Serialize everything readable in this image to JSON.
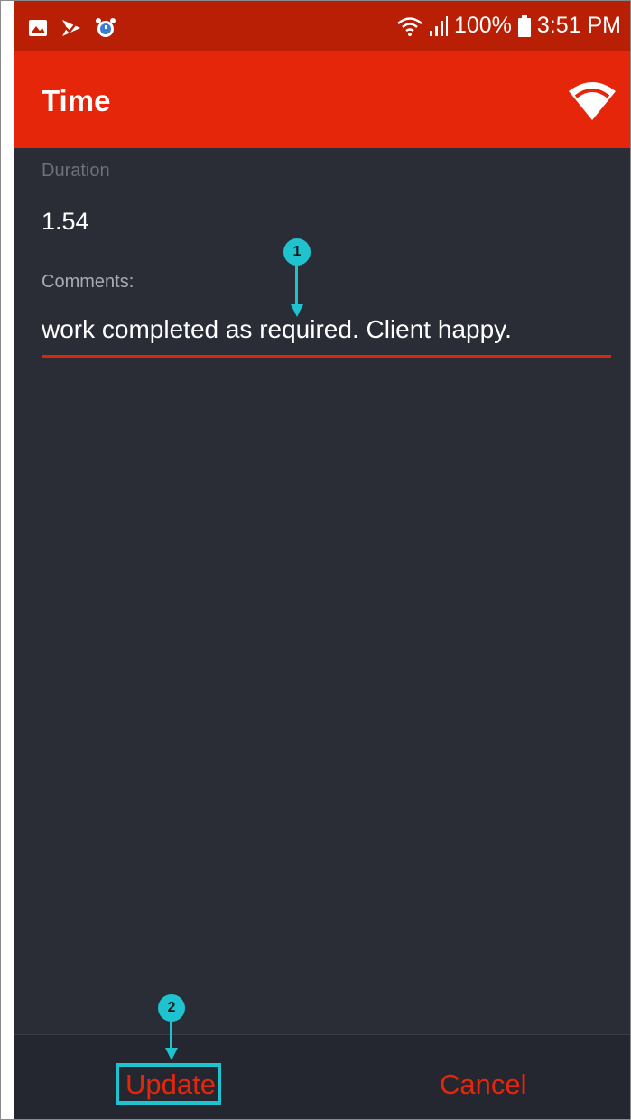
{
  "status_bar": {
    "battery": "100%",
    "time": "3:51 PM",
    "icons": [
      "image-icon",
      "check-flag-icon",
      "alarm-icon",
      "wifi-icon",
      "signal-icon",
      "battery-icon"
    ]
  },
  "app_bar": {
    "title": "Time",
    "sync_icon": "wifi-sync-icon"
  },
  "form": {
    "duration_label": "Duration",
    "duration_value": "1.54",
    "comments_label": "Comments:",
    "comments_value": "work completed as required. Client happy."
  },
  "actions": {
    "update_label": "Update",
    "cancel_label": "Cancel"
  },
  "callouts": {
    "marker_1": "1",
    "marker_2": "2"
  },
  "colors": {
    "status_bar": "#b81f05",
    "app_bar": "#e5260a",
    "background": "#2a2d36",
    "accent": "#e5260a",
    "callout": "#1ec3cf"
  }
}
